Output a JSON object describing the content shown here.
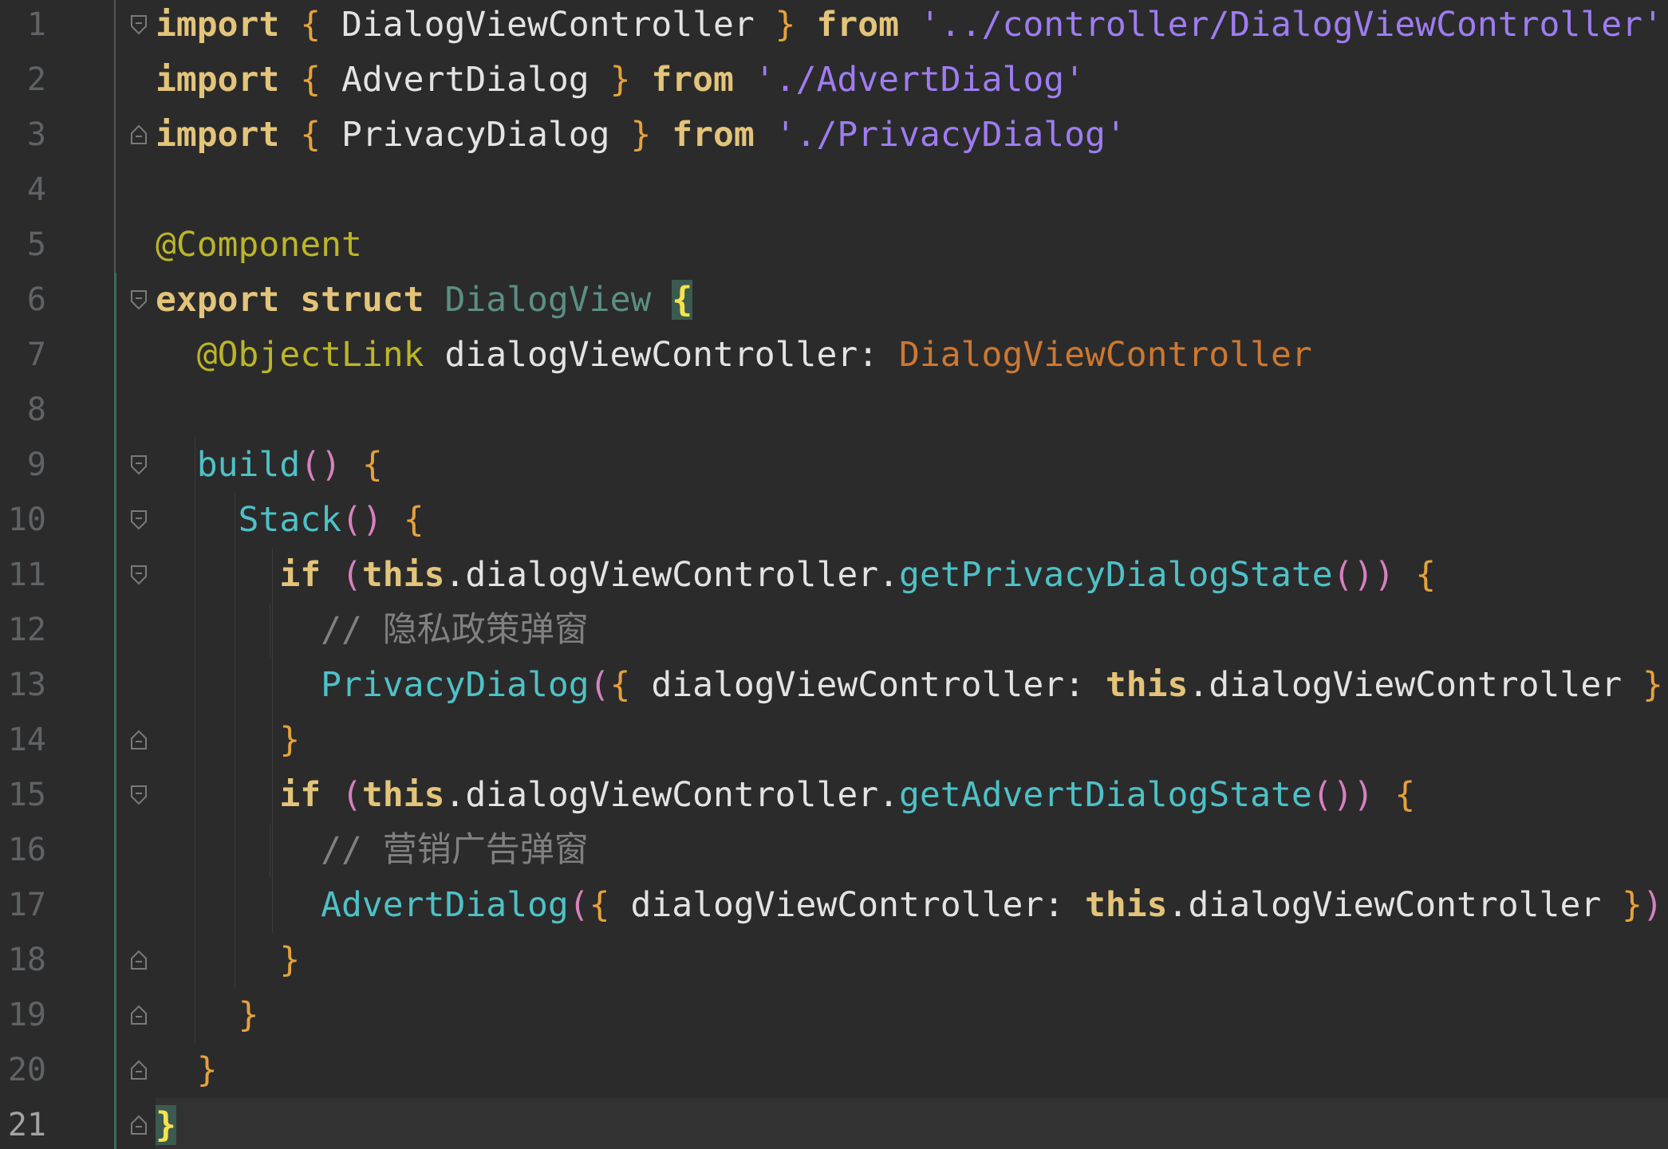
{
  "editor": {
    "language": "ArkTS",
    "current_line": 21,
    "line_numbers": [
      "1",
      "2",
      "3",
      "4",
      "5",
      "6",
      "7",
      "8",
      "9",
      "10",
      "11",
      "12",
      "13",
      "14",
      "15",
      "16",
      "17",
      "18",
      "19",
      "20",
      "21"
    ],
    "lines": [
      [
        {
          "t": "import",
          "c": "kw"
        },
        {
          "t": " ",
          "c": "plain"
        },
        {
          "t": "{",
          "c": "brace-o"
        },
        {
          "t": " DialogViewController ",
          "c": "plain"
        },
        {
          "t": "}",
          "c": "brace-o"
        },
        {
          "t": " ",
          "c": "plain"
        },
        {
          "t": "from",
          "c": "kw"
        },
        {
          "t": " ",
          "c": "plain"
        },
        {
          "t": "'../controller/DialogViewController'",
          "c": "str"
        }
      ],
      [
        {
          "t": "import",
          "c": "kw"
        },
        {
          "t": " ",
          "c": "plain"
        },
        {
          "t": "{",
          "c": "brace-o"
        },
        {
          "t": " AdvertDialog ",
          "c": "plain"
        },
        {
          "t": "}",
          "c": "brace-o"
        },
        {
          "t": " ",
          "c": "plain"
        },
        {
          "t": "from",
          "c": "kw"
        },
        {
          "t": " ",
          "c": "plain"
        },
        {
          "t": "'./AdvertDialog'",
          "c": "str"
        }
      ],
      [
        {
          "t": "import",
          "c": "kw"
        },
        {
          "t": " ",
          "c": "plain"
        },
        {
          "t": "{",
          "c": "brace-o"
        },
        {
          "t": " PrivacyDialog ",
          "c": "plain"
        },
        {
          "t": "}",
          "c": "brace-o"
        },
        {
          "t": " ",
          "c": "plain"
        },
        {
          "t": "from",
          "c": "kw"
        },
        {
          "t": " ",
          "c": "plain"
        },
        {
          "t": "'./PrivacyDialog'",
          "c": "str"
        }
      ],
      [],
      [
        {
          "t": "@Component",
          "c": "ann"
        }
      ],
      [
        {
          "t": "export",
          "c": "kw"
        },
        {
          "t": " ",
          "c": "plain"
        },
        {
          "t": "struct",
          "c": "kw"
        },
        {
          "t": " ",
          "c": "plain"
        },
        {
          "t": "DialogView",
          "c": "struct-name"
        },
        {
          "t": " ",
          "c": "plain"
        },
        {
          "t": "{",
          "c": "hl-brace"
        }
      ],
      [
        {
          "t": "  ",
          "c": "plain"
        },
        {
          "t": "@ObjectLink",
          "c": "ann"
        },
        {
          "t": " dialogViewController: ",
          "c": "plain"
        },
        {
          "t": "DialogViewController",
          "c": "type"
        }
      ],
      [],
      [
        {
          "t": "  ",
          "c": "plain"
        },
        {
          "t": "build",
          "c": "fn"
        },
        {
          "t": "()",
          "c": "paren"
        },
        {
          "t": " ",
          "c": "plain"
        },
        {
          "t": "{",
          "c": "brace-o"
        }
      ],
      [
        {
          "t": "    ",
          "c": "plain"
        },
        {
          "t": "Stack",
          "c": "fn"
        },
        {
          "t": "()",
          "c": "paren"
        },
        {
          "t": " ",
          "c": "plain"
        },
        {
          "t": "{",
          "c": "brace-o"
        }
      ],
      [
        {
          "t": "      ",
          "c": "plain"
        },
        {
          "t": "if",
          "c": "kw"
        },
        {
          "t": " ",
          "c": "plain"
        },
        {
          "t": "(",
          "c": "paren"
        },
        {
          "t": "this",
          "c": "kw"
        },
        {
          "t": ".dialogViewController.",
          "c": "plain"
        },
        {
          "t": "getPrivacyDialogState",
          "c": "fn"
        },
        {
          "t": "())",
          "c": "paren"
        },
        {
          "t": " ",
          "c": "plain"
        },
        {
          "t": "{",
          "c": "brace-o"
        }
      ],
      [
        {
          "t": "        ",
          "c": "plain"
        },
        {
          "t": "// 隐私政策弹窗",
          "c": "comment"
        }
      ],
      [
        {
          "t": "        ",
          "c": "plain"
        },
        {
          "t": "PrivacyDialog",
          "c": "fn"
        },
        {
          "t": "(",
          "c": "paren"
        },
        {
          "t": "{",
          "c": "brace-o"
        },
        {
          "t": " dialogViewController: ",
          "c": "plain"
        },
        {
          "t": "this",
          "c": "kw"
        },
        {
          "t": ".dialogViewController ",
          "c": "plain"
        },
        {
          "t": "}",
          "c": "brace-o"
        },
        {
          "t": ")",
          "c": "paren"
        }
      ],
      [
        {
          "t": "      ",
          "c": "plain"
        },
        {
          "t": "}",
          "c": "brace-o"
        }
      ],
      [
        {
          "t": "      ",
          "c": "plain"
        },
        {
          "t": "if",
          "c": "kw"
        },
        {
          "t": " ",
          "c": "plain"
        },
        {
          "t": "(",
          "c": "paren"
        },
        {
          "t": "this",
          "c": "kw"
        },
        {
          "t": ".dialogViewController.",
          "c": "plain"
        },
        {
          "t": "getAdvertDialogState",
          "c": "fn"
        },
        {
          "t": "())",
          "c": "paren"
        },
        {
          "t": " ",
          "c": "plain"
        },
        {
          "t": "{",
          "c": "brace-o"
        }
      ],
      [
        {
          "t": "        ",
          "c": "plain"
        },
        {
          "t": "// 营销广告弹窗",
          "c": "comment"
        }
      ],
      [
        {
          "t": "        ",
          "c": "plain"
        },
        {
          "t": "AdvertDialog",
          "c": "fn"
        },
        {
          "t": "(",
          "c": "paren"
        },
        {
          "t": "{",
          "c": "brace-o"
        },
        {
          "t": " dialogViewController: ",
          "c": "plain"
        },
        {
          "t": "this",
          "c": "kw"
        },
        {
          "t": ".dialogViewController ",
          "c": "plain"
        },
        {
          "t": "}",
          "c": "brace-o"
        },
        {
          "t": ")",
          "c": "paren"
        }
      ],
      [
        {
          "t": "      ",
          "c": "plain"
        },
        {
          "t": "}",
          "c": "brace-o"
        }
      ],
      [
        {
          "t": "    ",
          "c": "plain"
        },
        {
          "t": "}",
          "c": "brace-o"
        }
      ],
      [
        {
          "t": "  ",
          "c": "plain"
        },
        {
          "t": "}",
          "c": "brace-o"
        }
      ],
      [
        {
          "t": "}",
          "c": "hl-brace"
        }
      ]
    ]
  },
  "colors": {
    "background": "#2b2b2b",
    "keyword": "#e3c47a",
    "annotation": "#bbb529",
    "string": "#9f7cf1",
    "function": "#4ec1c7",
    "comment": "#808080",
    "type": "#cc7832",
    "brace": "#e6a13c"
  }
}
